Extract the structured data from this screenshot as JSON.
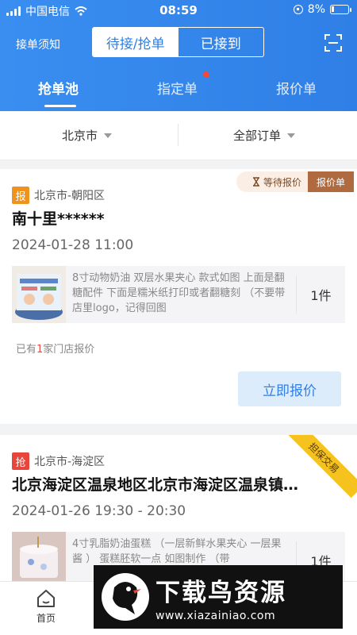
{
  "status_bar": {
    "carrier": "中国电信",
    "time": "08:59",
    "battery": "8%"
  },
  "header": {
    "notice_label": "接单须知",
    "segment": {
      "left": "待接/抢单",
      "right": "已接到",
      "selected": "left"
    },
    "tabs": [
      "抢单池",
      "指定单",
      "报价单"
    ],
    "active_tab": 0
  },
  "filter": {
    "city": "北京市",
    "order_type": "全部订单"
  },
  "orders": [
    {
      "status_tag": "等待报价",
      "type_tag": "报价单",
      "badge": "报",
      "badge_color": "#f0931e",
      "location": "北京市-朝阳区",
      "title": "南十里******",
      "time": "2024-01-28 11:00",
      "desc": "8寸动物奶油 双层水果夹心  款式如图 上面是翻糖配件 下面是糯米纸打印或者翻糖刻  （不要带店里logo，记得回图",
      "qty": "1件",
      "store_prefix": "已有",
      "store_count": "1",
      "store_suffix": "家门店报价",
      "action": "立即报价"
    },
    {
      "ribbon": "担保交易",
      "badge": "抢",
      "badge_color": "#e8453c",
      "location": "北京市-海淀区",
      "title": "北京海淀区温泉地区北京市海淀区温泉镇…",
      "time": "2024-01-26 19:30 - 20:30",
      "desc": "4寸乳脂奶油蛋糕  （一层新鲜水果夹心 一层果酱 ）  蛋糕胚软一点 如图制作 （带",
      "qty": "1件"
    }
  ],
  "bottom_nav": {
    "home": "首页"
  },
  "watermark": {
    "title": "下载鸟资源",
    "url": "www.xiazainiao.com"
  }
}
